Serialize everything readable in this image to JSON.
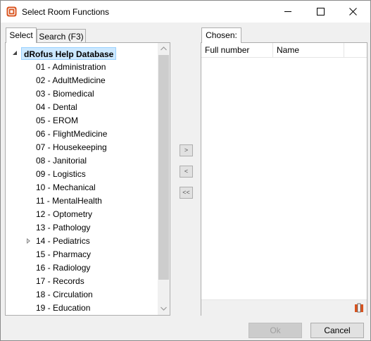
{
  "window": {
    "title": "Select Room Functions"
  },
  "left": {
    "tabs": [
      {
        "label": "Select",
        "active": true
      },
      {
        "label": "Search (F3)",
        "active": false
      }
    ],
    "tree": {
      "root_label": "dRofus Help Database",
      "items": [
        {
          "label": "01 - Administration",
          "expandable": false
        },
        {
          "label": "02 - AdultMedicine",
          "expandable": false
        },
        {
          "label": "03 - Biomedical",
          "expandable": false
        },
        {
          "label": "04 - Dental",
          "expandable": false
        },
        {
          "label": "05 - EROM",
          "expandable": false
        },
        {
          "label": "06 - FlightMedicine",
          "expandable": false
        },
        {
          "label": "07 - Housekeeping",
          "expandable": false
        },
        {
          "label": "08 - Janitorial",
          "expandable": false
        },
        {
          "label": "09 - Logistics",
          "expandable": false
        },
        {
          "label": "10 - Mechanical",
          "expandable": false
        },
        {
          "label": "11 - MentalHealth",
          "expandable": false
        },
        {
          "label": "12 - Optometry",
          "expandable": false
        },
        {
          "label": "13 - Pathology",
          "expandable": false
        },
        {
          "label": "14 - Pediatrics",
          "expandable": true
        },
        {
          "label": "15 - Pharmacy",
          "expandable": false
        },
        {
          "label": "16 - Radiology",
          "expandable": false
        },
        {
          "label": "17 - Records",
          "expandable": false
        },
        {
          "label": "18 - Circulation",
          "expandable": false
        },
        {
          "label": "19 - Education",
          "expandable": false
        }
      ]
    }
  },
  "middle": {
    "add_label": ">",
    "remove_label": "<",
    "remove_all_label": "<<"
  },
  "right": {
    "tab_label": "Chosen:",
    "columns": [
      "Full number",
      "Name"
    ],
    "rows": []
  },
  "buttons": {
    "ok_label": "Ok",
    "cancel_label": "Cancel"
  },
  "colors": {
    "selection_bg": "#cce8ff",
    "selection_border": "#99d1ff",
    "app_icon": "#d9531e"
  },
  "icons": {
    "app": "drofus-app-icon",
    "minimize": "minimize-icon",
    "maximize": "maximize-icon",
    "close": "close-icon",
    "footer": "columns-icon"
  }
}
